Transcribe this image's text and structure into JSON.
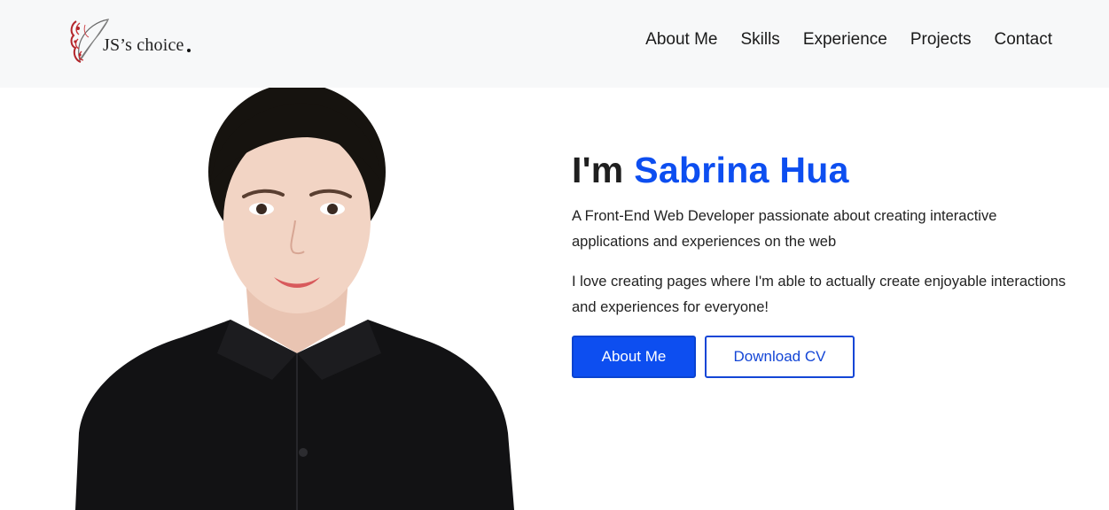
{
  "brand": {
    "text": "JS’s choice",
    "logo_icon": "quill-feather-icon"
  },
  "nav": {
    "items": [
      {
        "label": "About Me"
      },
      {
        "label": "Skills"
      },
      {
        "label": "Experience"
      },
      {
        "label": "Projects"
      },
      {
        "label": "Contact"
      }
    ]
  },
  "hero": {
    "greeting": "I'm",
    "name": "Sabrina Hua",
    "paragraph1": "A Front-End Web Developer passionate about creating interactive applications and experiences on the web",
    "paragraph2": "I love creating pages where I'm able to actually create enjoyable interactions and experiences for everyone!",
    "primary_button": "About Me",
    "secondary_button": "Download CV"
  },
  "colors": {
    "accent": "#0d4ef0",
    "navbar_bg": "#f7f8f9",
    "text": "#212529",
    "logo_red": "#b3262b"
  }
}
